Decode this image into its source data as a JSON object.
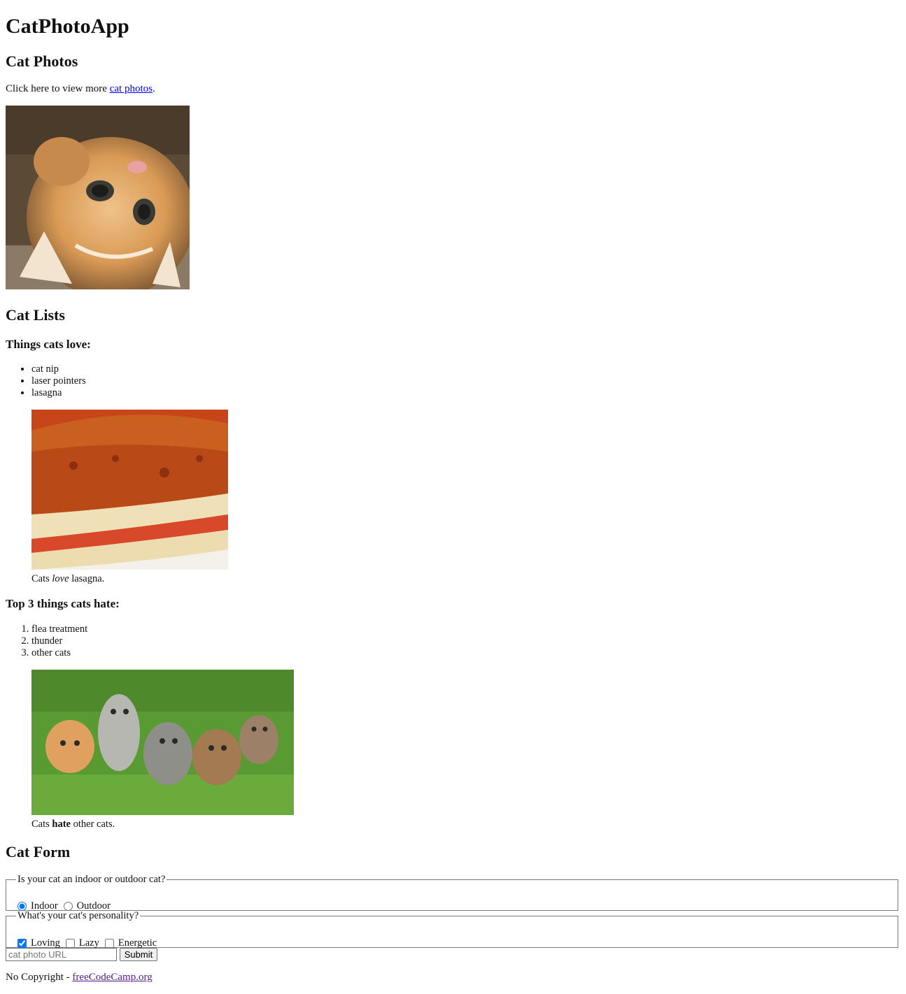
{
  "app_title": "CatPhotoApp",
  "photos_section": {
    "heading": "Cat Photos",
    "intro_prefix": "Click here to view more ",
    "link_text": "cat photos",
    "intro_suffix": "."
  },
  "lists_section": {
    "heading": "Cat Lists",
    "love_heading": "Things cats love:",
    "love_items": [
      "cat nip",
      "laser pointers",
      "lasagna"
    ],
    "love_caption": {
      "prefix": "Cats ",
      "emphasis": "love",
      "suffix": " lasagna."
    },
    "hate_heading": "Top 3 things cats hate:",
    "hate_items": [
      "flea treatment",
      "thunder",
      "other cats"
    ],
    "hate_caption": {
      "prefix": "Cats ",
      "emphasis": "hate",
      "suffix": " other cats."
    }
  },
  "form_section": {
    "heading": "Cat Form",
    "location_legend": "Is your cat an indoor or outdoor cat?",
    "location_options": [
      {
        "label": "Indoor",
        "checked": true
      },
      {
        "label": "Outdoor",
        "checked": false
      }
    ],
    "personality_legend": "What's your cat's personality?",
    "personality_options": [
      {
        "label": "Loving",
        "checked": true
      },
      {
        "label": "Lazy",
        "checked": false
      },
      {
        "label": "Energetic",
        "checked": false
      }
    ],
    "url_placeholder": "cat photo URL",
    "submit_label": "Submit"
  },
  "footer": {
    "prefix": "No Copyright - ",
    "link_text": "freeCodeCamp.org"
  },
  "images": {
    "kitten": "cat-photo",
    "lasagna": "lasagna-photo",
    "kittens": "kittens-photo"
  }
}
